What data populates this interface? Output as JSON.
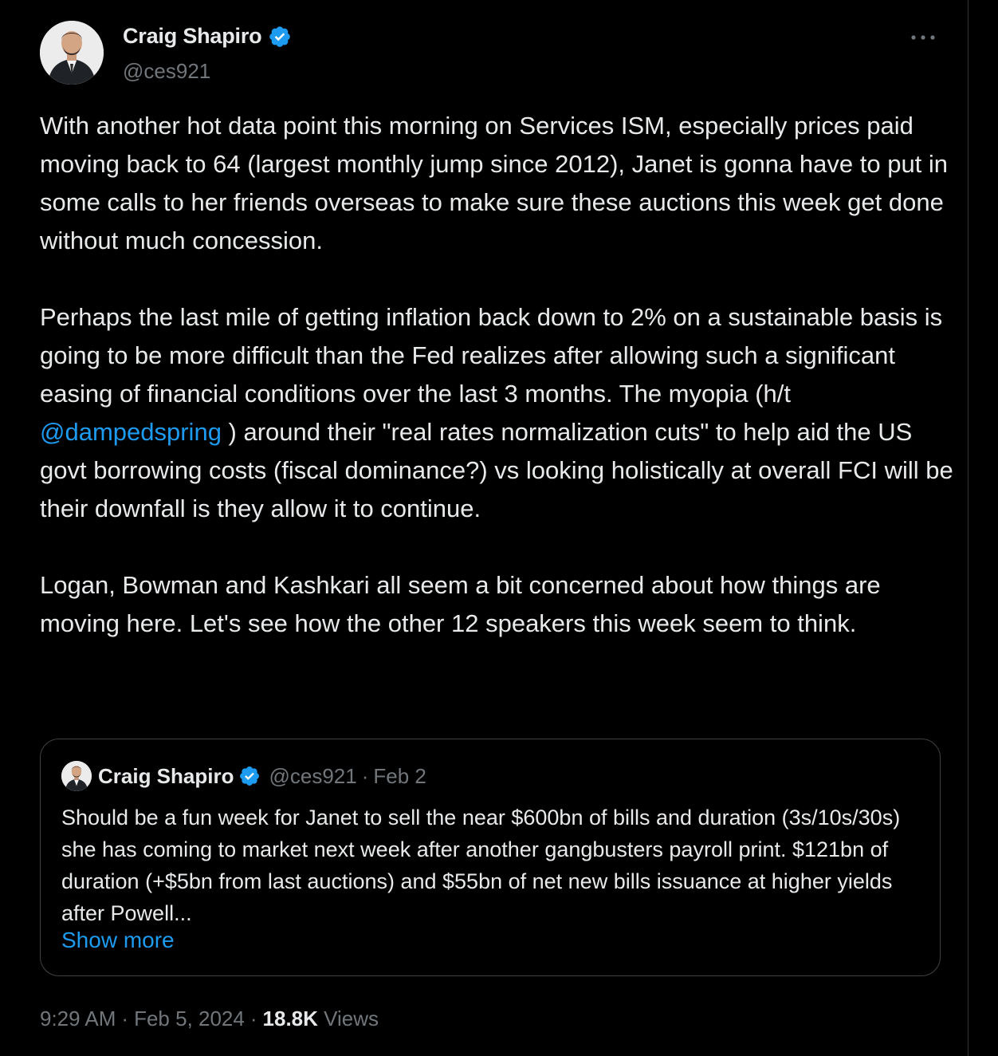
{
  "author": {
    "display_name": "Craig Shapiro",
    "handle": "@ces921"
  },
  "tweet": {
    "paragraph_1": "With another hot data point this morning on Services ISM, especially prices paid moving back to 64 (largest monthly jump since 2012), Janet is gonna have to put in some calls to her friends overseas to make sure these auctions this week get done without much concession.",
    "paragraph_2_before": "Perhaps the last mile of getting inflation back down to 2% on a sustainable basis is going to be more difficult than the Fed realizes after allowing such a significant easing of financial conditions over the last 3 months. The myopia (h/t ",
    "mention": "@dampedspring",
    "paragraph_2_after": " ) around their \"real rates normalization cuts\" to help aid the US govt borrowing costs (fiscal dominance?) vs looking holistically at overall FCI will be their downfall is they allow it to continue.",
    "paragraph_3": "Logan, Bowman and Kashkari all seem a bit concerned about how things are moving here. Let's see how the other 12 speakers this week seem to think."
  },
  "quoted_tweet": {
    "display_name": "Craig Shapiro",
    "handle": "@ces921",
    "separator": "·",
    "date": "Feb 2",
    "text": "Should be a fun week for Janet to sell the near $600bn of bills and duration (3s/10s/30s) she has coming to market next week after another gangbusters payroll print. $121bn of duration (+$5bn from last auctions) and $55bn of net new bills issuance at higher yields after Powell...",
    "show_more_label": "Show more"
  },
  "footer": {
    "time": "9:29 AM",
    "separator": "·",
    "date": "Feb 5, 2024",
    "views_count": "18.8K",
    "views_label": "Views"
  },
  "icons": {
    "verified": "verified-badge-icon",
    "more": "more-horizontal-icon"
  },
  "colors": {
    "background": "#000000",
    "text_primary": "#e7e9ea",
    "text_secondary": "#71767b",
    "accent": "#1d9bf0",
    "border": "#3e4144"
  }
}
